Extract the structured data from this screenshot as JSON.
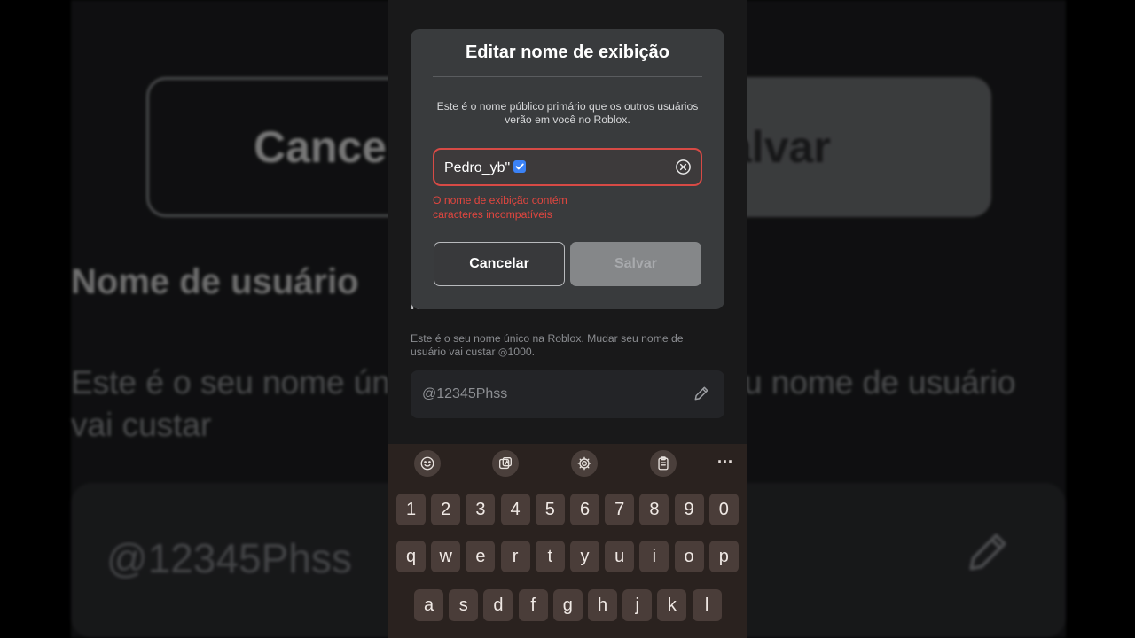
{
  "background": {
    "cancel_label": "Cance",
    "save_label": "alvar",
    "section_title": "Nome de usuário",
    "description": "Este é o seu nome único na Roblox. Mudar seu nome de usuário vai custar",
    "username": "@12345Phss"
  },
  "page": {
    "section_title": "Nome de usuário",
    "description": "Este é o seu nome único na Roblox. Mudar seu nome de usuário vai custar ◎1000.",
    "username": "@12345Phss"
  },
  "dialog": {
    "title": "Editar nome de exibição",
    "description": "Este é o nome público primário que os outros usuários verão em você no Roblox.",
    "input_value": "Pedro_yb\"",
    "error": "O nome de exibição contém caracteres incompatíveis",
    "cancel_label": "Cancelar",
    "save_label": "Salvar"
  },
  "keyboard": {
    "toolbar": [
      "emoji-icon",
      "sticker-icon",
      "settings-icon",
      "clipboard-icon"
    ],
    "more": "···",
    "rows": [
      [
        "1",
        "2",
        "3",
        "4",
        "5",
        "6",
        "7",
        "8",
        "9",
        "0"
      ],
      [
        "q",
        "w",
        "e",
        "r",
        "t",
        "y",
        "u",
        "i",
        "o",
        "p"
      ],
      [
        "a",
        "s",
        "d",
        "f",
        "g",
        "h",
        "j",
        "k",
        "l"
      ]
    ]
  },
  "colors": {
    "error": "#e2463f",
    "dialog_bg": "#393b3d",
    "keyboard_bg": "#2a221f",
    "verified_badge": "#3b82f6"
  }
}
